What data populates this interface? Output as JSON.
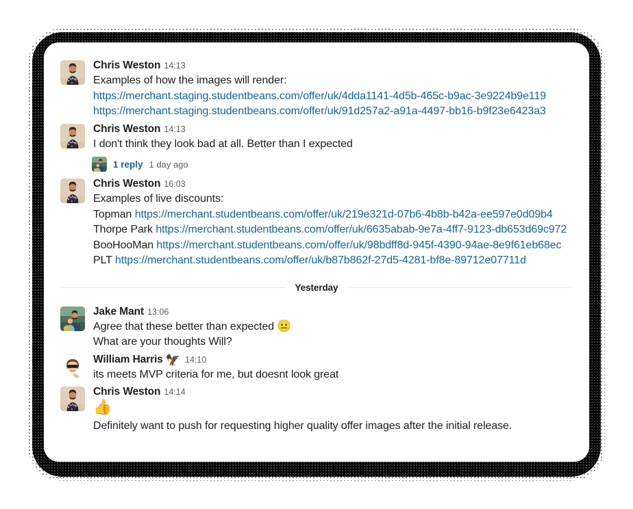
{
  "divider": {
    "label": "Yesterday"
  },
  "messages": [
    {
      "id": "msg-1",
      "author": "Chris Weston",
      "timestamp": "14:13",
      "avatar": "chris-weston-avatar",
      "lines": [
        {
          "type": "text",
          "text": "Examples of how the images will render:"
        },
        {
          "type": "link",
          "text": "https://merchant.staging.studentbeans.com/offer/uk/4dda1141-4d5b-465c-b9ac-3e9224b9e119"
        },
        {
          "type": "link",
          "text": "https://merchant.staging.studentbeans.com/offer/uk/91d257a2-a91a-4497-bb16-b9f23e6423a3"
        }
      ]
    },
    {
      "id": "msg-2",
      "author": "Chris Weston",
      "timestamp": "14:13",
      "avatar": "chris-weston-avatar",
      "lines": [
        {
          "type": "text",
          "text": "I don't think they look bad at all. Better than I expected"
        }
      ],
      "thread": {
        "reply_count": "1 reply",
        "last_reply": "1 day ago",
        "avatar": "jake-mant-avatar"
      }
    },
    {
      "id": "msg-3",
      "author": "Chris Weston",
      "timestamp": "16:03",
      "avatar": "chris-weston-avatar",
      "lines": [
        {
          "type": "text",
          "text": "Examples of live discounts:"
        },
        {
          "type": "prefixed-link",
          "prefix": "Topman",
          "text": "https://merchant.studentbeans.com/offer/uk/219e321d-07b6-4b8b-b42a-ee597e0d09b4"
        },
        {
          "type": "prefixed-link",
          "prefix": "Thorpe Park",
          "text": "https://merchant.studentbeans.com/offer/uk/6635abab-9e7a-4ff7-9123-db653d69c972"
        },
        {
          "type": "prefixed-link",
          "prefix": "BooHooMan",
          "text": "https://merchant.studentbeans.com/offer/uk/98bdff8d-945f-4390-94ae-8e9f61eb68ec"
        },
        {
          "type": "prefixed-link",
          "prefix": "PLT",
          "text": "https://merchant.studentbeans.com/offer/uk/b87b862f-27d5-4281-bf8e-89712e07711d"
        }
      ]
    },
    {
      "id": "msg-4",
      "author": "Jake Mant",
      "timestamp": "13:06",
      "avatar": "jake-mant-avatar",
      "lines": [
        {
          "type": "text-emoji",
          "text": "Agree that these better than expected ",
          "emoji": "😐"
        },
        {
          "type": "text",
          "text": "What are your thoughts Will?"
        }
      ]
    },
    {
      "id": "msg-5",
      "author": "William Harris",
      "timestamp": "14:10",
      "avatar": "william-harris-avatar",
      "status_emoji": "🦅",
      "lines": [
        {
          "type": "text",
          "text": "its meets MVP criteria for me, but doesnt look great"
        }
      ]
    },
    {
      "id": "msg-6",
      "author": "Chris Weston",
      "timestamp": "14:14",
      "avatar": "chris-weston-avatar",
      "lines": [
        {
          "type": "emoji-only",
          "emoji": "👍"
        },
        {
          "type": "text",
          "text": "Definitely want to push for requesting higher quality offer images after the initial release."
        }
      ]
    }
  ],
  "colors": {
    "link": "#1264a3",
    "text": "#1d1c1d",
    "muted": "#616061",
    "card": "#ffffff",
    "backdrop": "#000000"
  }
}
